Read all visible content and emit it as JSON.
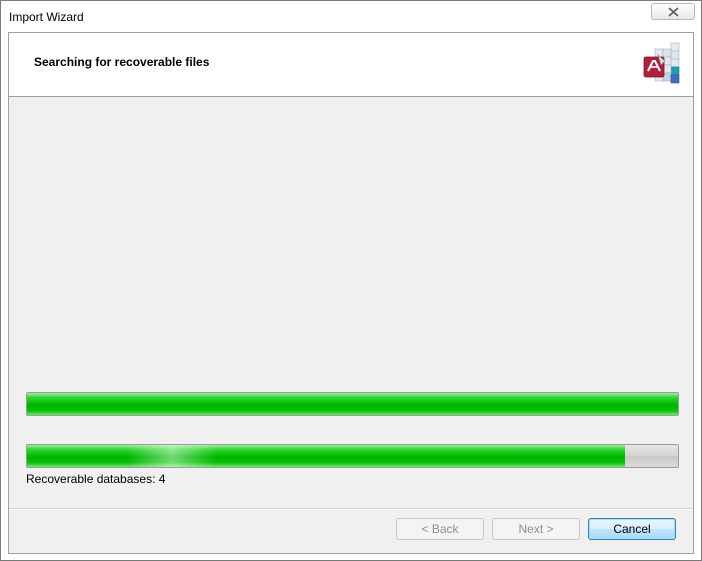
{
  "window": {
    "title": "Import Wizard"
  },
  "header": {
    "title": "Searching for recoverable files",
    "logo_icon": "database-recovery-icon"
  },
  "progress": {
    "overall_fraction": 1.0,
    "current_fraction": 0.918
  },
  "status": {
    "recoverable_text": "Recoverable databases: 4"
  },
  "buttons": {
    "back_label": "< Back",
    "next_label": "Next >",
    "cancel_label": "Cancel"
  },
  "colors": {
    "progress_green": "#03c203",
    "accent_blue": "#3c7fb1"
  }
}
